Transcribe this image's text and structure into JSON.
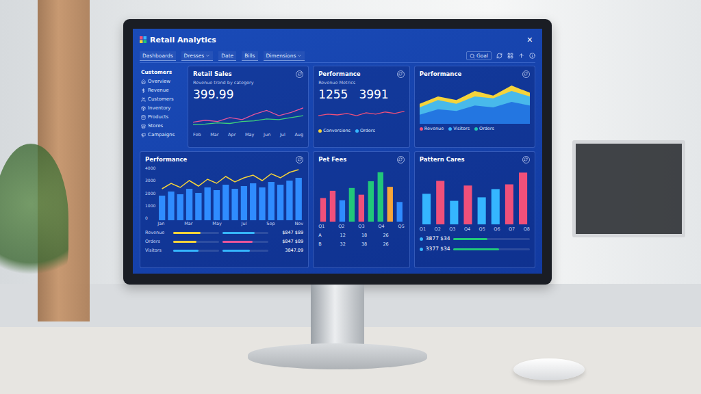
{
  "window": {
    "title": "Retail Analytics",
    "close": "×"
  },
  "toolbar": {
    "filters": [
      {
        "label": "Dashboards",
        "dropdown": false
      },
      {
        "label": "Dresses",
        "dropdown": true
      },
      {
        "label": "Date",
        "dropdown": false
      },
      {
        "label": "Bills",
        "dropdown": false
      },
      {
        "label": "Dimensions",
        "dropdown": true
      }
    ],
    "search": "Goal"
  },
  "sidebar": {
    "title": "Customers",
    "items": [
      "Overview",
      "Revenue",
      "Customers",
      "Inventory",
      "Products",
      "Stores",
      "Campaigns"
    ]
  },
  "retail_sales": {
    "title": "Retail Sales",
    "subtitle": "Revenue trend by category",
    "value": "399.99",
    "series": [
      {
        "color": "#e8559a",
        "values": [
          12,
          15,
          13,
          19,
          16,
          24,
          30,
          22,
          27,
          34
        ]
      },
      {
        "color": "#3fd27a",
        "values": [
          8,
          9,
          11,
          10,
          13,
          14,
          17,
          16,
          19,
          22
        ]
      }
    ],
    "x_labels": [
      "Feb",
      "Mar",
      "Apr",
      "May",
      "Jun",
      "Jul",
      "Aug"
    ]
  },
  "performance_kpi": {
    "title": "Performance",
    "subtitle": "Revenue Metrics",
    "values": [
      "1255",
      "3991"
    ],
    "series": [
      {
        "color": "#f0507a",
        "values": [
          14,
          16,
          15,
          17,
          14,
          18,
          16,
          19,
          17,
          20
        ]
      }
    ],
    "legend": [
      {
        "label": "Conversions",
        "color": "#f5d33a"
      },
      {
        "label": "Orders",
        "color": "#35b6ff"
      }
    ]
  },
  "performance_area": {
    "title": "Performance",
    "series": [
      {
        "color": "#f5d33a",
        "values": [
          22,
          30,
          26,
          36,
          31,
          42,
          34
        ]
      },
      {
        "color": "#35b6ff",
        "values": [
          18,
          26,
          22,
          30,
          28,
          36,
          30
        ]
      },
      {
        "color": "#1f6fe0",
        "values": [
          10,
          16,
          14,
          20,
          18,
          24,
          20
        ]
      }
    ],
    "legend": [
      {
        "label": "Revenue",
        "color": "#f0507a"
      },
      {
        "label": "Visitors",
        "color": "#35b6ff"
      },
      {
        "label": "Orders",
        "color": "#21c7b0"
      }
    ]
  },
  "performance_bars": {
    "title": "Performance",
    "y_ticks": [
      "4000",
      "3000",
      "2000",
      "1000",
      "0"
    ],
    "bar_color": "#2f8cff",
    "bars": [
      1800,
      2100,
      1900,
      2300,
      2000,
      2400,
      2200,
      2600,
      2300,
      2500,
      2700,
      2400,
      2800,
      2600,
      2900,
      3100
    ],
    "line": {
      "color": "#f5d33a",
      "values": [
        2300,
        2700,
        2400,
        2900,
        2500,
        3000,
        2700,
        3200,
        2800,
        3100,
        3300,
        2900,
        3400,
        3100,
        3500,
        3700
      ]
    },
    "x_labels": [
      "Jan",
      "Mar",
      "May",
      "Jul",
      "Sep",
      "Nov"
    ],
    "rows": [
      {
        "label": "Revenue",
        "value": "$847 $89",
        "bars": [
          {
            "color": "#f5d33a",
            "level": 0.6
          },
          {
            "color": "#35b6ff",
            "level": 0.7
          }
        ]
      },
      {
        "label": "Orders",
        "value": "$847 $89",
        "bars": [
          {
            "color": "#f5d33a",
            "level": 0.5
          },
          {
            "color": "#e8559a",
            "level": 0.65
          }
        ]
      },
      {
        "label": "Visitors",
        "value": "3847.09",
        "bars": [
          {
            "color": "#35b6ff",
            "level": 0.55
          },
          {
            "color": "#35b6ff",
            "level": 0.6
          }
        ]
      }
    ]
  },
  "pet_fees": {
    "title": "Pet Fees",
    "bars": [
      {
        "value": 42,
        "color": "#f0507a"
      },
      {
        "value": 55,
        "color": "#f0507a"
      },
      {
        "value": 38,
        "color": "#2f8cff"
      },
      {
        "value": 60,
        "color": "#21c77a"
      },
      {
        "value": 48,
        "color": "#f0507a"
      },
      {
        "value": 72,
        "color": "#21c77a"
      },
      {
        "value": 88,
        "color": "#21c77a"
      },
      {
        "value": 62,
        "color": "#f5a53a"
      },
      {
        "value": 35,
        "color": "#2f8cff"
      }
    ],
    "x_labels": [
      "Q1",
      "Q2",
      "Q3",
      "Q4",
      "Q5"
    ],
    "rows": [
      [
        "A",
        "12",
        "18",
        "26"
      ],
      [
        "B",
        "32",
        "38",
        "26"
      ]
    ]
  },
  "pattern_cares": {
    "title": "Pattern Cares",
    "bars": [
      {
        "value": 52,
        "color": "#35b6ff"
      },
      {
        "value": 74,
        "color": "#f0507a"
      },
      {
        "value": 40,
        "color": "#35b6ff"
      },
      {
        "value": 66,
        "color": "#f0507a"
      },
      {
        "value": 46,
        "color": "#35b6ff"
      },
      {
        "value": 60,
        "color": "#35b6ff"
      },
      {
        "value": 68,
        "color": "#f0507a"
      },
      {
        "value": 88,
        "color": "#f0507a"
      }
    ],
    "x_labels": [
      "Q1",
      "Q2",
      "Q3",
      "Q4",
      "Q5",
      "Q6",
      "Q7",
      "Q8"
    ],
    "stats": [
      {
        "value": "3877 $34",
        "color": "#35b6ff",
        "level": 0.45
      },
      {
        "value": "3377 $34",
        "color": "#35b6ff",
        "level": 0.6
      }
    ]
  }
}
